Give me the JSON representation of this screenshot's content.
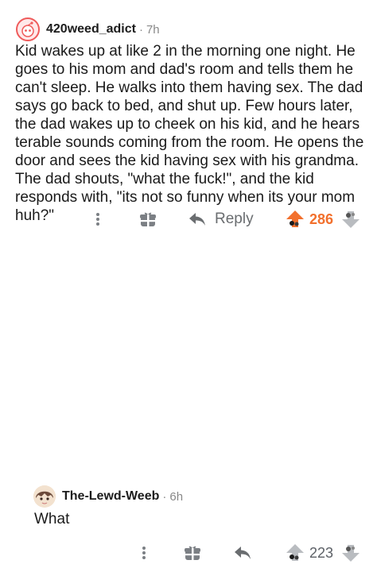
{
  "comments": [
    {
      "username": "420weed_adict",
      "separator": "·",
      "age": "7h",
      "text": "Kid wakes up at like 2 in the morning one night. He goes to his mom and dad's room and tells them he can't sleep. He walks into them having sex. The dad says go back to bed, and shut up. Few hours later, the dad wakes up to cheek on his kid, and he hears terable sounds coming from the room. He opens the door and sees the kid having sex with his grandma. The dad shouts, \"what the fuck!\", and the kid responds with, \"its not so funny when its your mom huh?\"",
      "reply_label": "Reply",
      "score": "286",
      "vote_state": "upvoted",
      "icons": [
        "more-vertical-icon",
        "gift-award-icon",
        "reply-arrow-icon",
        "upvote-icon",
        "downvote-icon"
      ]
    },
    {
      "username": "The-Lewd-Weeb",
      "separator": "·",
      "age": "6h",
      "text": "What",
      "score": "223",
      "vote_state": "none",
      "icons": [
        "more-vertical-icon",
        "gift-award-icon",
        "reply-arrow-icon",
        "upvote-icon",
        "downvote-icon"
      ]
    }
  ],
  "colors": {
    "upvoted_score": "#f2702d",
    "neutral_score": "#5c6066",
    "icon_gray": "#7b7f84",
    "meta_gray": "#888888"
  }
}
